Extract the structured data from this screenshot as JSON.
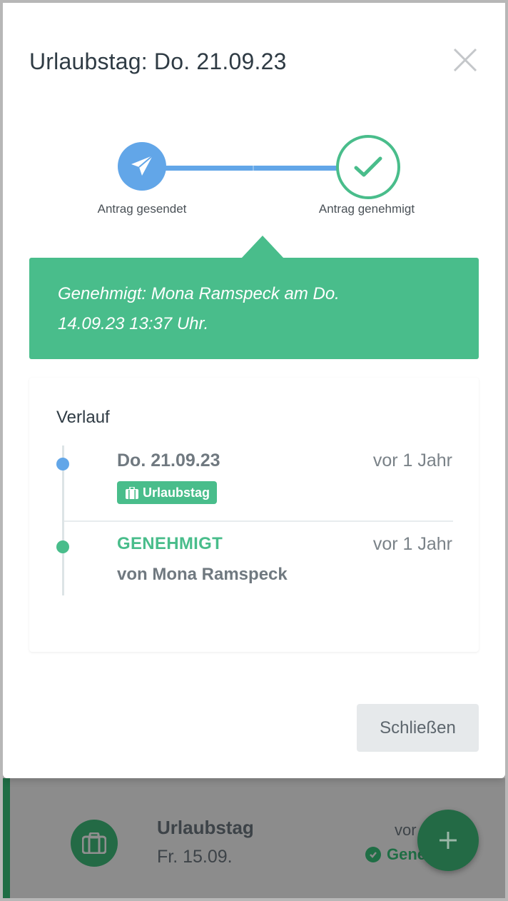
{
  "modal": {
    "title": "Urlaubstag: Do. 21.09.23",
    "steps": [
      {
        "label": "Antrag gesendet",
        "icon": "paper-plane-icon",
        "color": "#62a6e8"
      },
      {
        "label": "Antrag genehmigt",
        "icon": "check-icon",
        "color": "#49bd8b"
      }
    ],
    "callout": {
      "line1": "Genehmigt: Mona Ramspeck am Do.",
      "line2": "14.09.23 13:37 Uhr."
    },
    "history": {
      "title": "Verlauf",
      "entries": [
        {
          "title": "Do. 21.09.23",
          "time": "vor 1 Jahr",
          "tag": "Urlaubstag"
        },
        {
          "title": "GENEHMIGT",
          "time": "vor 1 Jahr",
          "subtitle": "von Mona Ramspeck"
        }
      ]
    },
    "close_button_label": "Schließen"
  },
  "background_item": {
    "title": "Urlaubstag",
    "date": "Fr. 15.09.",
    "time_partial": "vor",
    "status_partial": "Gene"
  },
  "colors": {
    "accent_green": "#49bd8b",
    "accent_blue": "#62a6e8",
    "dark_green": "#236a45"
  }
}
